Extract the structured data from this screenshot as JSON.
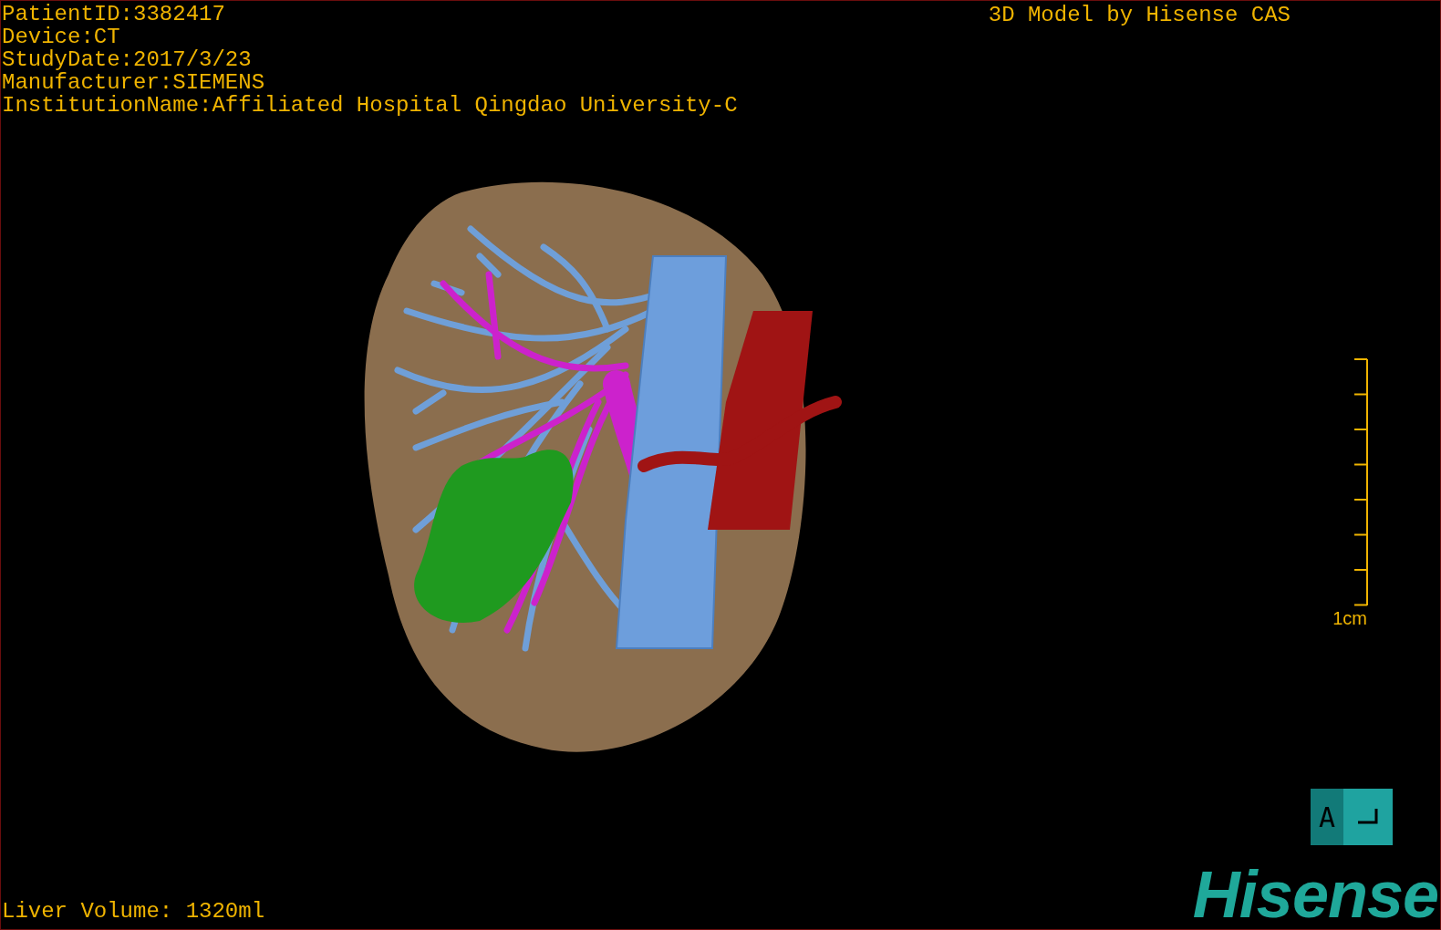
{
  "info_lines": [
    "PatientID:3382417",
    "Device:CT",
    "StudyDate:2017/3/23",
    "Manufacturer:SIEMENS",
    "InstitutionName:Affiliated Hospital Qingdao University-C"
  ],
  "title": "3D Model by Hisense CAS",
  "scale_bar": {
    "label": "1cm"
  },
  "orientation_cube": {
    "label": "A"
  },
  "volume": "Liver Volume: 1320ml",
  "logo": "Hisense"
}
